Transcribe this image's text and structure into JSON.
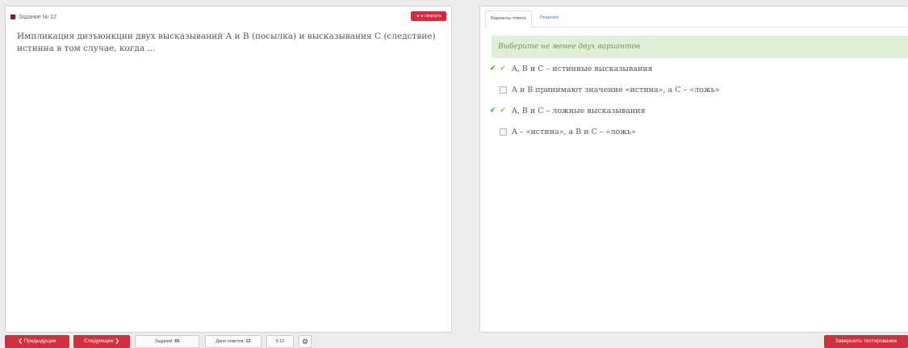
{
  "task": {
    "label": "Задание № 12",
    "collapse_label": "◄◄ свернуть",
    "question": "Импликация дизъюнкции двух высказываний A и B (посылка) и высказывания C (следствие) истинна в том случае, когда …"
  },
  "tabs": [
    {
      "label": "Варианты ответа",
      "active": true
    },
    {
      "label": "Решение",
      "active": false
    }
  ],
  "hint": "Выберите не менее двух вариантов",
  "options": [
    {
      "text": "A, B и C – истинные высказывания",
      "checked": true,
      "correct": true
    },
    {
      "text": "A и B принимают значение «истина», а C – «ложь»",
      "checked": false,
      "correct": false
    },
    {
      "text": "A, B и C – ложные высказывания",
      "checked": true,
      "correct": true
    },
    {
      "text": "A – «истина», а B и C – «ложь»",
      "checked": false,
      "correct": false
    }
  ],
  "footer": {
    "prev_label": "❮ Предыдущее",
    "next_label": "Следующее ❯",
    "tasks_label": "Заданий:",
    "tasks_count": "65",
    "answers_label": "Дано ответов:",
    "answers_count": "12",
    "progress": "5:12",
    "settings_icon": "gear-icon",
    "finish_label": "Завершить тестирование"
  },
  "colors": {
    "accent_red": "#d32f3f",
    "task_marker": "#8b1a2b",
    "hint_bg": "#dff0d8",
    "check_green": "#8dc63f",
    "link_blue": "#3a7cc2"
  }
}
